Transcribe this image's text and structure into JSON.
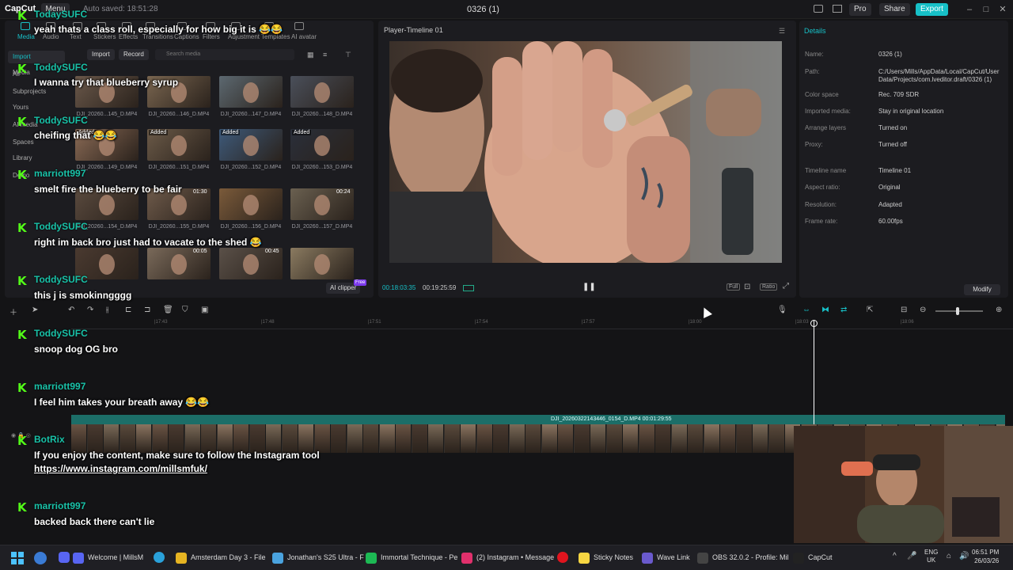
{
  "titlebar": {
    "app_name": "CapCut",
    "menu_label": "Menu",
    "autosave": "Auto saved: 18:51:28",
    "project_title": "0326 (1)",
    "pro_label": "Pro",
    "share_label": "Share",
    "export_label": "Export"
  },
  "media": {
    "tabs": [
      "Media",
      "Audio",
      "Text",
      "Stickers",
      "Effects",
      "Transitions",
      "Captions",
      "Filters",
      "Adjustment",
      "Templates",
      "AI avatar"
    ],
    "nav": [
      "Import",
      "Media",
      "All",
      "Subprojects",
      "Yours",
      "AI media",
      "Spaces",
      "Library",
      "Demo"
    ],
    "import_label": "Import",
    "record_label": "Record",
    "search_placeholder": "Search media",
    "ai_clipper_label": "AI clipper",
    "ai_clipper_badge": "Free",
    "thumbnails": [
      {
        "label": "DJI_20260...145_D.MP4",
        "badge": ""
      },
      {
        "label": "DJI_20260...146_D.MP4",
        "badge": ""
      },
      {
        "label": "DJI_20260...147_D.MP4",
        "badge": ""
      },
      {
        "label": "DJI_20260...148_D.MP4",
        "badge": ""
      },
      {
        "label": "DJI_20260...149_D.MP4",
        "badge": "Added"
      },
      {
        "label": "DJI_20260...151_D.MP4",
        "badge": "Added"
      },
      {
        "label": "DJI_20260...152_D.MP4",
        "badge": "Added"
      },
      {
        "label": "DJI_20260...153_D.MP4",
        "badge": "Added"
      },
      {
        "label": "DJI_20260...154_D.MP4",
        "badge": ""
      },
      {
        "label": "DJI_20260...155_D.MP4",
        "badge": ""
      },
      {
        "label": "DJI_20260...156_D.MP4",
        "badge": ""
      },
      {
        "label": "DJI_20260...157_D.MP4",
        "badge": ""
      },
      {
        "label": "",
        "badge": ""
      },
      {
        "label": "",
        "badge": ""
      },
      {
        "label": "",
        "badge": ""
      },
      {
        "label": "",
        "badge": ""
      }
    ],
    "durations": [
      "01:30",
      "00:24",
      "00:05",
      "00:45"
    ]
  },
  "chat": [
    {
      "user": "TodaySUFC",
      "message": "yeah thats a class roll, especially for how big it is 😂😂"
    },
    {
      "user": "ToddySUFC",
      "message": "I wanna try that blueberry syrup"
    },
    {
      "user": "ToddySUFC",
      "message": "cheifing that 😂😂"
    },
    {
      "user": "marriott997",
      "message": "smelt fire the blueberry to be fair"
    },
    {
      "user": "ToddySUFC",
      "message": "right im back bro just had to vacate to the shed 😂"
    },
    {
      "user": "ToddySUFC",
      "message": "this j is smokinngggg"
    },
    {
      "user": "ToddySUFC",
      "message": "snoop dog OG bro"
    },
    {
      "user": "marriott997",
      "message": "I feel him takes your breath away 😂😂"
    },
    {
      "user": "BotRix",
      "message": "If you enjoy the content, make sure to follow the Instagram tool",
      "link": "https://www.instagram.com/millsmfuk/"
    },
    {
      "user": "marriott997",
      "message": "backed back there can't lie"
    }
  ],
  "player": {
    "title": "Player-Timeline 01",
    "current_time": "00:18:03:35",
    "total_time": "00:19:25:59",
    "controls": [
      "Full",
      "Ratio"
    ]
  },
  "details": {
    "title": "Details",
    "rows": [
      {
        "label": "Name:",
        "value": "0326 (1)"
      },
      {
        "label": "Path:",
        "value": "C:/Users/Mills/AppData/Local/CapCut/User Data/Projects/com.lveditor.draft/0326 (1)"
      },
      {
        "label": "Color space",
        "value": "Rec. 709 SDR"
      },
      {
        "label": "Imported media:",
        "value": "Stay in original location"
      },
      {
        "label": "Arrange layers",
        "value": "Turned on"
      },
      {
        "label": "Proxy:",
        "value": "Turned off"
      },
      {
        "label": "Timeline name",
        "value": "Timeline 01"
      },
      {
        "label": "Aspect ratio:",
        "value": "Original"
      },
      {
        "label": "Resolution:",
        "value": "Adapted"
      },
      {
        "label": "Frame rate:",
        "value": "60.00fps"
      }
    ],
    "modify_label": "Modify"
  },
  "timeline": {
    "ruler": [
      "|17:43",
      "|17:48",
      "|17:51",
      "|17:54",
      "|17:57",
      "|18:00",
      "|18:03",
      "|18:06"
    ],
    "clip_title": "DJI_20260322143446_0154_D.MP4   00:01:29:55"
  },
  "taskbar": {
    "items": [
      {
        "label": "Welcome | MillsM",
        "color": "#5865f2"
      },
      {
        "label": "Amsterdam Day 3 - File",
        "color": "#e6b422"
      },
      {
        "label": "Jonathan's S25 Ultra - F",
        "color": "#4aa3df"
      },
      {
        "label": "Immortal Technique - Pe",
        "color": "#1db954"
      },
      {
        "label": "(2) Instagram • Message",
        "color": "#e1306c"
      },
      {
        "label": "Sticky Notes",
        "color": "#f7d642"
      },
      {
        "label": "Wave Link",
        "color": "#6a5acd"
      },
      {
        "label": "OBS 32.0.2 - Profile: Mil",
        "color": "#444"
      },
      {
        "label": "CapCut",
        "color": "#222"
      }
    ],
    "lang": "ENG",
    "region": "UK",
    "time": "06:51 PM",
    "date": "26/03/26"
  }
}
